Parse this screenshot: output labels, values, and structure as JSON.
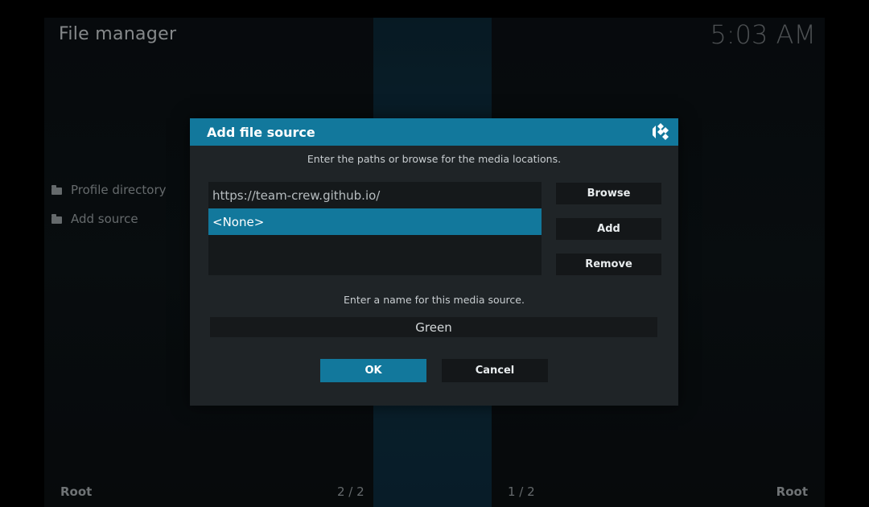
{
  "window": {
    "title": "File manager",
    "clock": "5:03 AM"
  },
  "sidebar": {
    "items": [
      {
        "label": "Profile directory",
        "icon": "folder-icon"
      },
      {
        "label": "Add source",
        "icon": "folder-icon"
      }
    ]
  },
  "footer": {
    "left_root": "Root",
    "left_page": "2 / 2",
    "right_page": "1 / 2",
    "right_root": "Root"
  },
  "dialog": {
    "title": "Add file source",
    "logo": "kodi-logo",
    "instruction": "Enter the paths or browse for the media locations.",
    "paths": [
      {
        "value": "https://team-crew.github.io/",
        "selected": false
      },
      {
        "value": "<None>",
        "selected": true
      }
    ],
    "buttons": {
      "browse": "Browse",
      "add": "Add",
      "remove": "Remove"
    },
    "name_label": "Enter a name for this media source.",
    "name_value": "Green",
    "ok": "OK",
    "cancel": "Cancel"
  },
  "colors": {
    "accent": "#12789c",
    "dialog_bg": "#1f2427",
    "text_muted": "#8d9396"
  }
}
